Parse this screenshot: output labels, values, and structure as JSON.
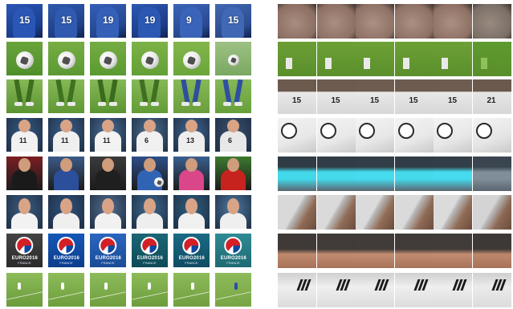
{
  "left_grid": {
    "rows": [
      {
        "theme": "blue-kits",
        "tiles": [
          {
            "bg": "#1b3f8f",
            "accent": "#2a56b5",
            "number": "15"
          },
          {
            "bg": "#203f87",
            "accent": "#2f5ab0",
            "number": "15"
          },
          {
            "bg": "#24468f",
            "accent": "#3560b7",
            "number": "19"
          },
          {
            "bg": "#1e3c86",
            "accent": "#2b58b3",
            "number": "19"
          },
          {
            "bg": "#2a4a90",
            "accent": "#3a64b9",
            "number": "9"
          },
          {
            "bg": "#2d4c8e",
            "accent": "#4068b4",
            "number": "15"
          }
        ]
      },
      {
        "theme": "ball-on-grass",
        "tiles": [
          {
            "bg": "#4f8f2a",
            "accent": "#6aa43b"
          },
          {
            "bg": "#5c9932",
            "accent": "#77ad44"
          },
          {
            "bg": "#5a9a30",
            "accent": "#74ac42"
          },
          {
            "bg": "#62a035",
            "accent": "#7db248"
          },
          {
            "bg": "#6aa63a",
            "accent": "#83b64c"
          },
          {
            "bg": "#7aa861",
            "accent": "#9dc184"
          }
        ]
      },
      {
        "theme": "legs-on-grass",
        "tiles": [
          {
            "bg": "#5a9430",
            "accent": "#3c6e1e"
          },
          {
            "bg": "#5f9834",
            "accent": "#3f7220"
          },
          {
            "bg": "#5b9531",
            "accent": "#3a6b1c"
          },
          {
            "bg": "#629b36",
            "accent": "#416f22"
          },
          {
            "bg": "#6a9f3b",
            "accent": "#2f4e9e"
          },
          {
            "bg": "#66a03a",
            "accent": "#2f4fa3"
          }
        ]
      },
      {
        "theme": "white-kits",
        "tiles": [
          {
            "bg": "#355a86",
            "accent": "#f1f1f1",
            "number": "11"
          },
          {
            "bg": "#3a608c",
            "accent": "#efefef",
            "number": "11"
          },
          {
            "bg": "#4a6e97",
            "accent": "#f2f2f2",
            "number": "11"
          },
          {
            "bg": "#4e6f8f",
            "accent": "#f0f0f0",
            "number": "6"
          },
          {
            "bg": "#416590",
            "accent": "#eeeeee",
            "number": "13"
          },
          {
            "bg": "#3a4f6c",
            "accent": "#e8e8e8",
            "number": "6"
          }
        ]
      },
      {
        "theme": "mixed-kits",
        "tiles": [
          {
            "bg": "#7a1e22",
            "accent": "#1a1a1a"
          },
          {
            "bg": "#3b5b88",
            "accent": "#2b4f9a"
          },
          {
            "bg": "#3b3b3b",
            "accent": "#1f1f1f"
          },
          {
            "bg": "#2d4f87",
            "accent": "#3163b5"
          },
          {
            "bg": "#3a5f8f",
            "accent": "#d94689"
          },
          {
            "bg": "#3d7a2e",
            "accent": "#c7231e"
          }
        ]
      },
      {
        "theme": "faces",
        "tiles": [
          {
            "bg": "#3b5e82",
            "accent": "#f2f2f2"
          },
          {
            "bg": "#30507c",
            "accent": "#efefef"
          },
          {
            "bg": "#556f8f",
            "accent": "#f1f1f1"
          },
          {
            "bg": "#3e6a8f",
            "accent": "#eeeeee"
          },
          {
            "bg": "#2f5f7f",
            "accent": "#f0f0f0"
          },
          {
            "bg": "#4e7aa0",
            "accent": "#efefef"
          }
        ]
      },
      {
        "theme": "euro-logo",
        "tiles": [
          {
            "bg": "#2a2a2a",
            "accent": "#444444"
          },
          {
            "bg": "#0d3d8c",
            "accent": "#1457b8"
          },
          {
            "bg": "#1a4b96",
            "accent": "#2a66c0"
          },
          {
            "bg": "#0e4a57",
            "accent": "#1b6676"
          },
          {
            "bg": "#0f4c63",
            "accent": "#1b6a85"
          },
          {
            "bg": "#1d6a73",
            "accent": "#2f8b94"
          }
        ]
      },
      {
        "theme": "wide-pitch",
        "tiles": [
          {
            "bg": "#6a9b3a",
            "accent": "#ffffff"
          },
          {
            "bg": "#6d9e3c",
            "accent": "#ffffff"
          },
          {
            "bg": "#709f3e",
            "accent": "#ffffff"
          },
          {
            "bg": "#6c9c3b",
            "accent": "#ffffff"
          },
          {
            "bg": "#719f3f",
            "accent": "#ffffff"
          },
          {
            "bg": "#78a545",
            "accent": "#2c4fa8"
          }
        ]
      }
    ],
    "logo_text": "EURO2016",
    "logo_sub": "FRANCE"
  },
  "right_grid": {
    "rows": [
      {
        "theme": "blurred-face",
        "tiles": [
          {
            "bg": "#8c6f62",
            "accent": "#a88d80"
          },
          {
            "bg": "#8e7064",
            "accent": "#a98e82"
          },
          {
            "bg": "#8f7266",
            "accent": "#ab9084"
          },
          {
            "bg": "#8d7165",
            "accent": "#aa8f83"
          },
          {
            "bg": "#8e7164",
            "accent": "#aa8f82"
          },
          {
            "bg": "#7a6f66",
            "accent": "#9a8a80"
          }
        ]
      },
      {
        "theme": "grass-edge",
        "tiles": [
          {
            "bg": "#6c9e35",
            "accent": "#e8e8e8"
          },
          {
            "bg": "#6da036",
            "accent": "#e9e9e9"
          },
          {
            "bg": "#6ea137",
            "accent": "#eaeaea"
          },
          {
            "bg": "#6d9f36",
            "accent": "#e9e9e9"
          },
          {
            "bg": "#6ea037",
            "accent": "#e9e9e9"
          },
          {
            "bg": "#5e9a2f",
            "accent": "#8fc15a"
          }
        ]
      },
      {
        "theme": "white-shirt-number",
        "tiles": [
          {
            "bg": "#e9e9e9",
            "accent": "#6b5a4d",
            "number": "15"
          },
          {
            "bg": "#e8e8e8",
            "accent": "#6c5b4e",
            "number": "15"
          },
          {
            "bg": "#e9e9e9",
            "accent": "#6d5c4f",
            "number": "15"
          },
          {
            "bg": "#e8e8e8",
            "accent": "#6c5b4e",
            "number": "15"
          },
          {
            "bg": "#e9e9e9",
            "accent": "#6d5c4f",
            "number": "15"
          },
          {
            "bg": "#e6e6e6",
            "accent": "#6a594c",
            "number": "21"
          }
        ]
      },
      {
        "theme": "crest-closeup",
        "tiles": [
          {
            "bg": "#e7e7e7",
            "accent": "#2b2b2b"
          },
          {
            "bg": "#e8e8e8",
            "accent": "#2c2c2c"
          },
          {
            "bg": "#e7e7e7",
            "accent": "#2b2b2b"
          },
          {
            "bg": "#e8e8e8",
            "accent": "#2c2c2c"
          },
          {
            "bg": "#e7e7e7",
            "accent": "#2b2b2b"
          },
          {
            "bg": "#e5e5e5",
            "accent": "#2a2a2a"
          }
        ]
      },
      {
        "theme": "cyan-blur",
        "tiles": [
          {
            "bg": "#2f3b45",
            "accent": "#41d9ea"
          },
          {
            "bg": "#303c46",
            "accent": "#43dbec"
          },
          {
            "bg": "#313d47",
            "accent": "#44dcee"
          },
          {
            "bg": "#303c46",
            "accent": "#43dbec"
          },
          {
            "bg": "#313d47",
            "accent": "#44dcee"
          },
          {
            "bg": "#3a4550",
            "accent": "#7f8e98"
          }
        ]
      },
      {
        "theme": "arm-closeup",
        "tiles": [
          {
            "bg": "#d9d9d9",
            "accent": "#8f6a55"
          },
          {
            "bg": "#dadada",
            "accent": "#906b56"
          },
          {
            "bg": "#dbdbdb",
            "accent": "#916c57"
          },
          {
            "bg": "#dadada",
            "accent": "#906b56"
          },
          {
            "bg": "#dbdbdb",
            "accent": "#916c57"
          },
          {
            "bg": "#d4d4d4",
            "accent": "#8c6854"
          }
        ]
      },
      {
        "theme": "dark-hair",
        "tiles": [
          {
            "bg": "#3f3a37",
            "accent": "#c08a6e"
          },
          {
            "bg": "#403b38",
            "accent": "#c28c70"
          },
          {
            "bg": "#413c39",
            "accent": "#c38d71"
          },
          {
            "bg": "#403b38",
            "accent": "#c28c70"
          },
          {
            "bg": "#413c39",
            "accent": "#c38d71"
          },
          {
            "bg": "#3d3936",
            "accent": "#be886c"
          }
        ]
      },
      {
        "theme": "white-shirt-stripes",
        "tiles": [
          {
            "bg": "#eeeeee",
            "accent": "#1a1a1a"
          },
          {
            "bg": "#efefef",
            "accent": "#1b1b1b"
          },
          {
            "bg": "#eeeeee",
            "accent": "#1a1a1a"
          },
          {
            "bg": "#efefef",
            "accent": "#1b1b1b"
          },
          {
            "bg": "#eeeeee",
            "accent": "#1a1a1a"
          },
          {
            "bg": "#ebebeb",
            "accent": "#191919"
          }
        ]
      }
    ]
  }
}
